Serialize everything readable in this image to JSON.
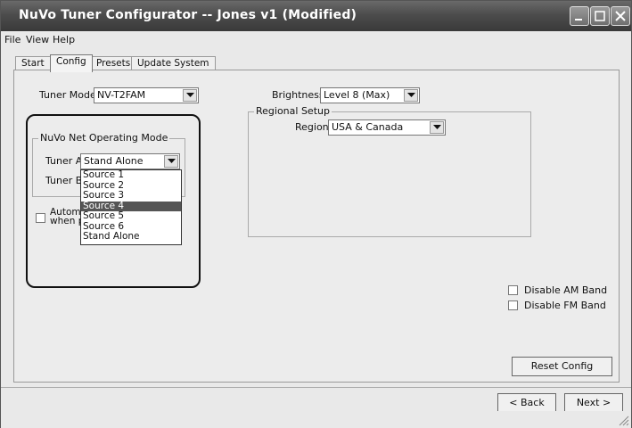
{
  "window": {
    "title": "NuVo Tuner Configurator -- Jones v1 (Modified)"
  },
  "menu": {
    "file": "File",
    "view": "View",
    "help": "Help"
  },
  "tabs": [
    "Start",
    "Config",
    "Presets",
    "Update System"
  ],
  "config": {
    "tuner_mode_label": "Tuner Mode:",
    "tuner_mode_value": "NV-T2FAM",
    "brightness_label": "Brightness:",
    "brightness_value": "Level 8 (Max)",
    "regional_setup_label": "Regional Setup",
    "region_label": "Region:",
    "region_value": "USA & Canada",
    "net_mode_group": "NuVo Net Operating Mode",
    "tuner_a_label": "Tuner A:",
    "tuner_a_value": "Stand Alone",
    "tuner_b_label": "Tuner B:",
    "auto_line1": "Automat",
    "auto_line2": "when p",
    "dropdown_options": [
      "Source 1",
      "Source 2",
      "Source 3",
      "Source 4",
      "Source 5",
      "Source 6",
      "Stand Alone"
    ],
    "dropdown_selected_index": 3,
    "disable_am_label": "Disable AM Band",
    "disable_fm_label": "Disable FM Band",
    "reset_button": "Reset Config"
  },
  "nav": {
    "back": "< Back",
    "next": "Next >"
  },
  "colors": {
    "titlebar": "#4c4c4c",
    "selected_option": "#555555"
  }
}
